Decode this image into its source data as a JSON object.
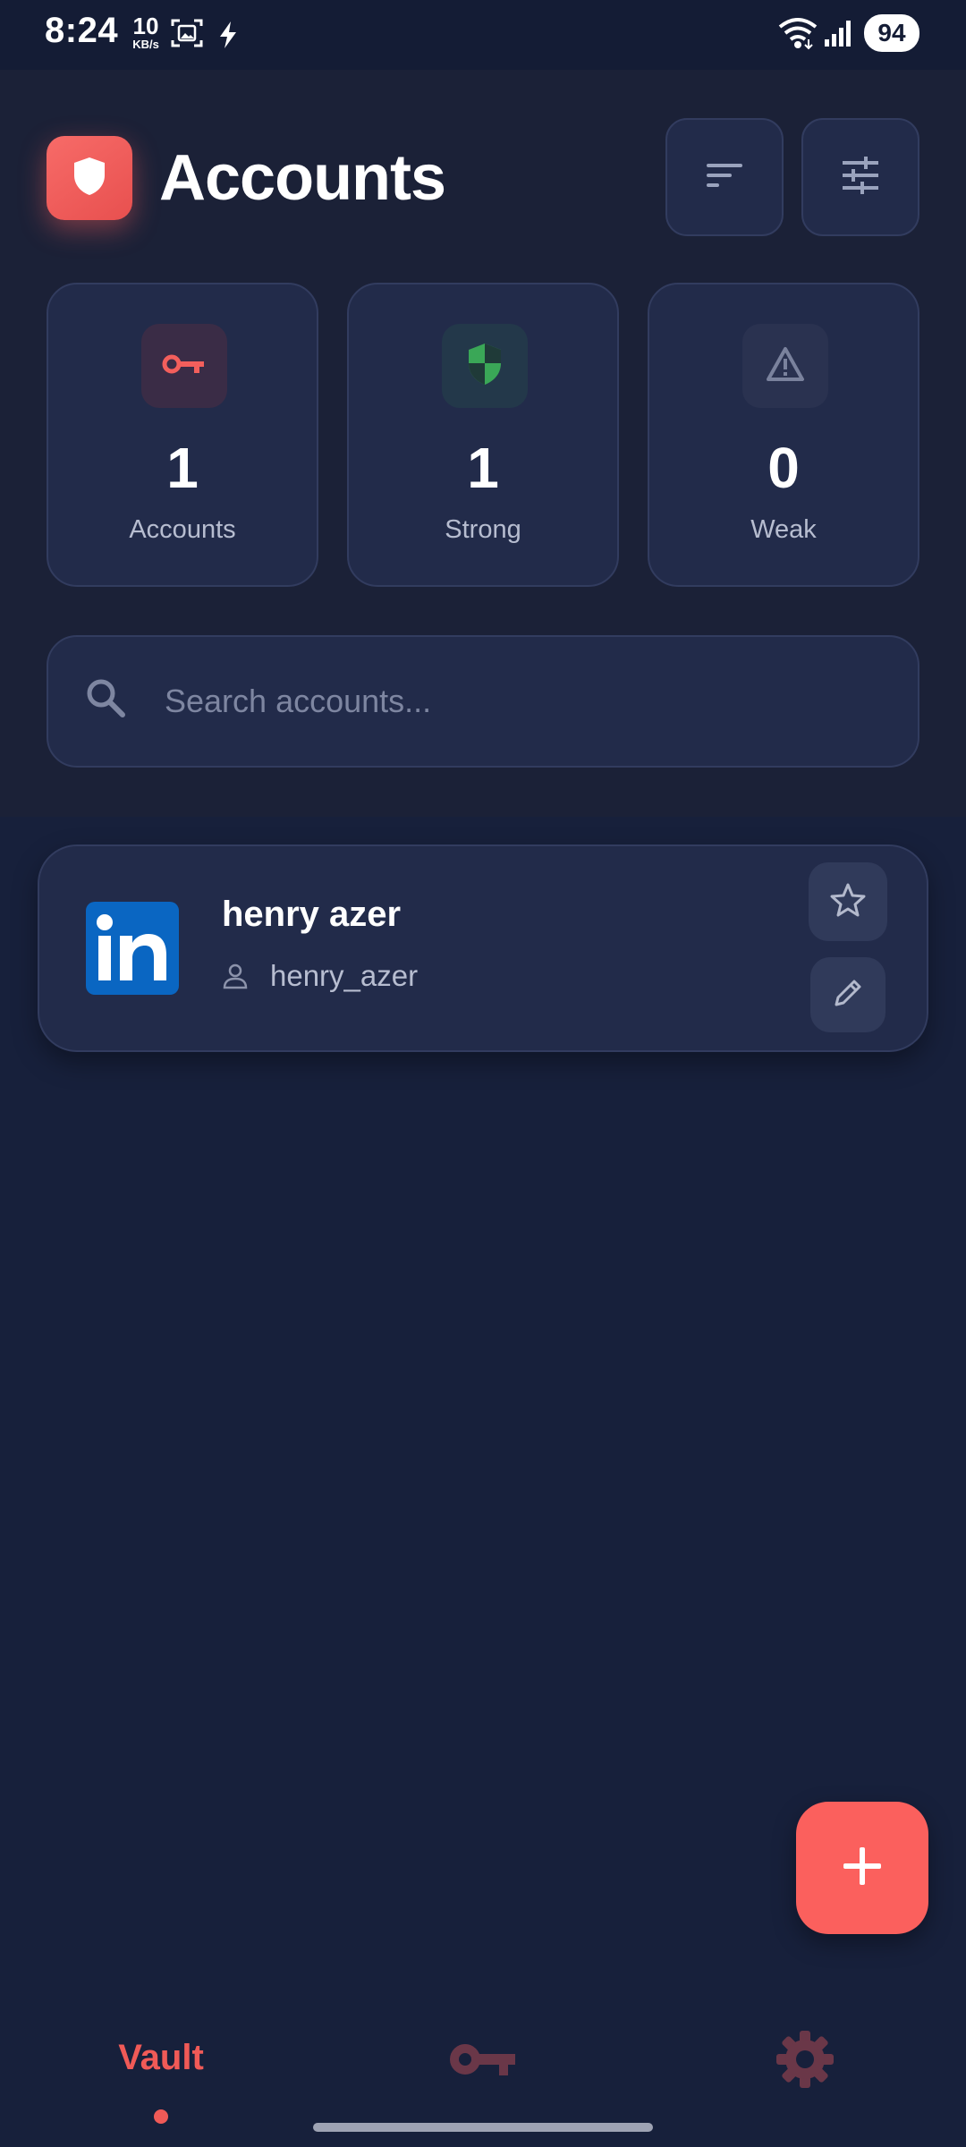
{
  "status_bar": {
    "time": "8:24",
    "net_speed": "10",
    "net_unit": "KB/s",
    "battery": "94"
  },
  "header": {
    "title": "Accounts",
    "accent_color": "#f05a57"
  },
  "stats": [
    {
      "value": "1",
      "label": "Accounts",
      "icon": "key-icon"
    },
    {
      "value": "1",
      "label": "Strong",
      "icon": "shield-icon"
    },
    {
      "value": "0",
      "label": "Weak",
      "icon": "warning-icon"
    }
  ],
  "search": {
    "placeholder": "Search accounts..."
  },
  "accounts": [
    {
      "name": "henry azer",
      "username": "henry_azer",
      "icon": "linkedin-logo"
    }
  ],
  "bottom_nav": {
    "vault_label": "Vault",
    "items": [
      "Vault",
      "key-icon",
      "gear-icon"
    ]
  }
}
